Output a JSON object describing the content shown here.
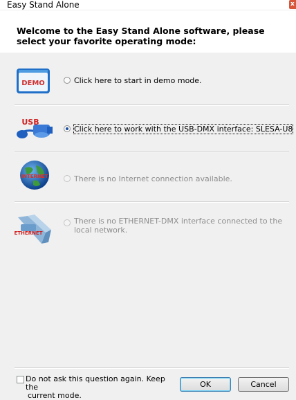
{
  "window": {
    "title": "Easy Stand Alone",
    "close_glyph": "x"
  },
  "header": {
    "text": "Welcome to the Easy Stand Alone software, please select your favorite operating mode:"
  },
  "options": [
    {
      "icon": "demo-icon",
      "icon_text": "DEMO",
      "label": "Click here to start in demo mode.",
      "state": "unchecked",
      "enabled": true
    },
    {
      "icon": "usb-icon",
      "icon_text": "USB",
      "label": "Click here to work with the USB-DMX interface:  SLESA-U8",
      "state": "checked",
      "enabled": true
    },
    {
      "icon": "internet-icon",
      "icon_text": "INTERNET",
      "label": "There is no Internet connection available.",
      "state": "unchecked",
      "enabled": false
    },
    {
      "icon": "ethernet-icon",
      "icon_text": "ETHERNET",
      "label_line1": "There is no ETHERNET-DMX interface connected to the",
      "label_line2": "local network.",
      "state": "unchecked",
      "enabled": false
    }
  ],
  "footer": {
    "checkbox_line1": "Do not ask this question again. Keep the",
    "checkbox_line2": "current mode.",
    "checkbox_checked": false,
    "ok_label": "OK",
    "cancel_label": "Cancel"
  },
  "colors": {
    "accent": "#1a4fa0",
    "disabled_text": "#8d8d8d",
    "panel_bg": "#f0f0f0"
  }
}
